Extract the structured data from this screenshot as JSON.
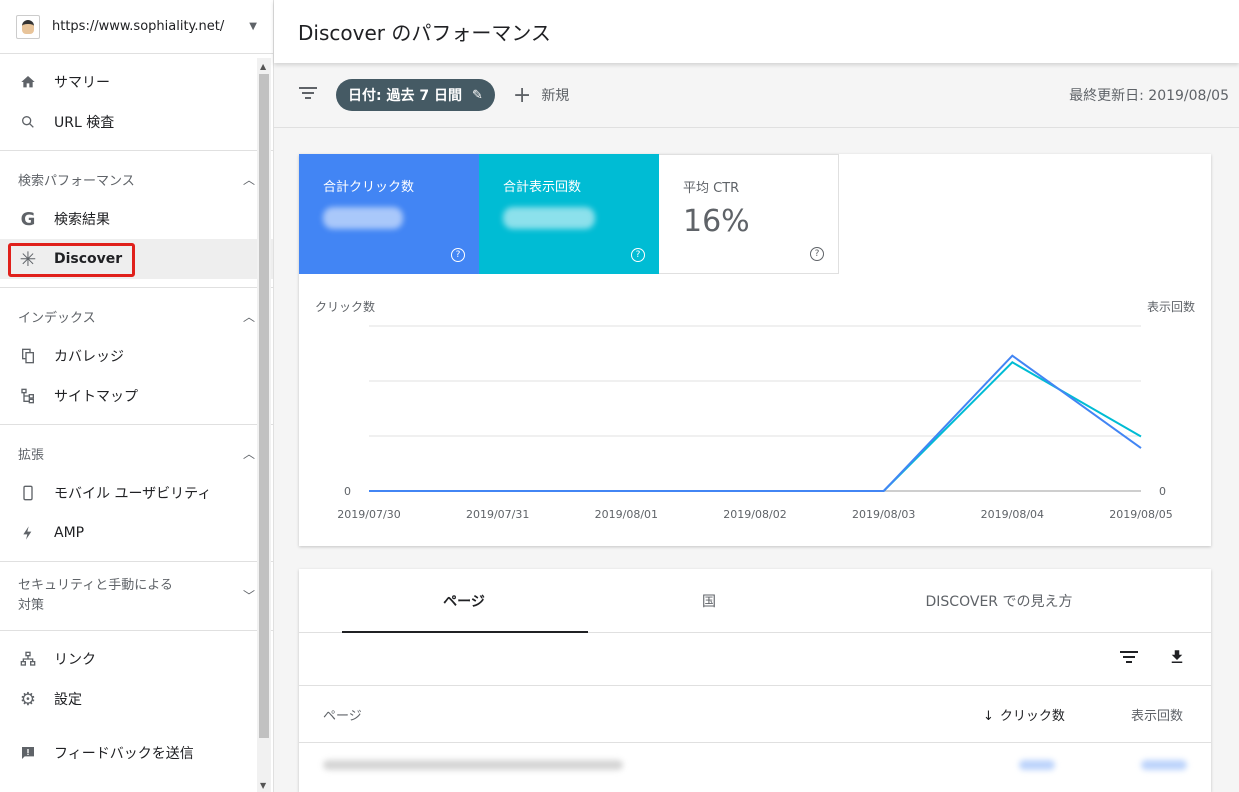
{
  "property": {
    "url": "https://www.sophiality.net/"
  },
  "sidebar": {
    "top": [
      {
        "icon": "home-icon",
        "label": "サマリー"
      },
      {
        "icon": "search-icon",
        "label": "URL 検査"
      }
    ],
    "performance": {
      "title": "検索パフォーマンス",
      "items": [
        {
          "icon": "google-g-icon",
          "label": "検索結果"
        },
        {
          "icon": "asterisk-icon",
          "label": "Discover"
        }
      ]
    },
    "index": {
      "title": "インデックス",
      "items": [
        {
          "icon": "file-copy-icon",
          "label": "カバレッジ"
        },
        {
          "icon": "sitemap-icon",
          "label": "サイトマップ"
        }
      ]
    },
    "enhancements": {
      "title": "拡張",
      "items": [
        {
          "icon": "smartphone-icon",
          "label": "モバイル ユーザビリティ"
        },
        {
          "icon": "bolt-icon",
          "label": "AMP"
        }
      ]
    },
    "security": {
      "title_line1": "セキュリティと手動による",
      "title_line2": "対策"
    },
    "bottom": [
      {
        "icon": "links-icon",
        "label": "リンク"
      },
      {
        "icon": "gear-icon",
        "label": "設定"
      }
    ],
    "feedback": {
      "icon": "feedback-icon",
      "label": "フィードバックを送信"
    }
  },
  "header": {
    "title": "Discover のパフォーマンス"
  },
  "filters": {
    "date_chip": "日付: 過去 7 日間",
    "new_label": "新規",
    "last_updated": "最終更新日: 2019/08/05"
  },
  "metrics": {
    "clicks_label": "合計クリック数",
    "impressions_label": "合計表示回数",
    "ctr_label": "平均 CTR",
    "ctr_value": "16%"
  },
  "chart_data": {
    "type": "line",
    "x": [
      "2019/07/30",
      "2019/07/31",
      "2019/08/01",
      "2019/08/02",
      "2019/08/03",
      "2019/08/04",
      "2019/08/05"
    ],
    "ylabel_left": "クリック数",
    "ylabel_right": "表示回数",
    "y_zero_label_left": "0",
    "y_zero_label_right": "0",
    "series": [
      {
        "name": "クリック数",
        "color": "#4285f4",
        "values": [
          0,
          0,
          0,
          0,
          0,
          0.82,
          0.26
        ]
      },
      {
        "name": "表示回数",
        "color": "#00bcd4",
        "values": [
          0,
          0,
          0,
          0,
          0,
          0.78,
          0.33
        ]
      }
    ],
    "grid": true
  },
  "table": {
    "tabs": [
      "ページ",
      "国",
      "DISCOVER での見え方"
    ],
    "active_tab": 0,
    "headers": {
      "page": "ページ",
      "clicks": "クリック数",
      "impressions": "表示回数"
    }
  },
  "colors": {
    "clicks": "#4285f4",
    "impressions": "#00bcd4",
    "highlight": "#e0201b"
  }
}
